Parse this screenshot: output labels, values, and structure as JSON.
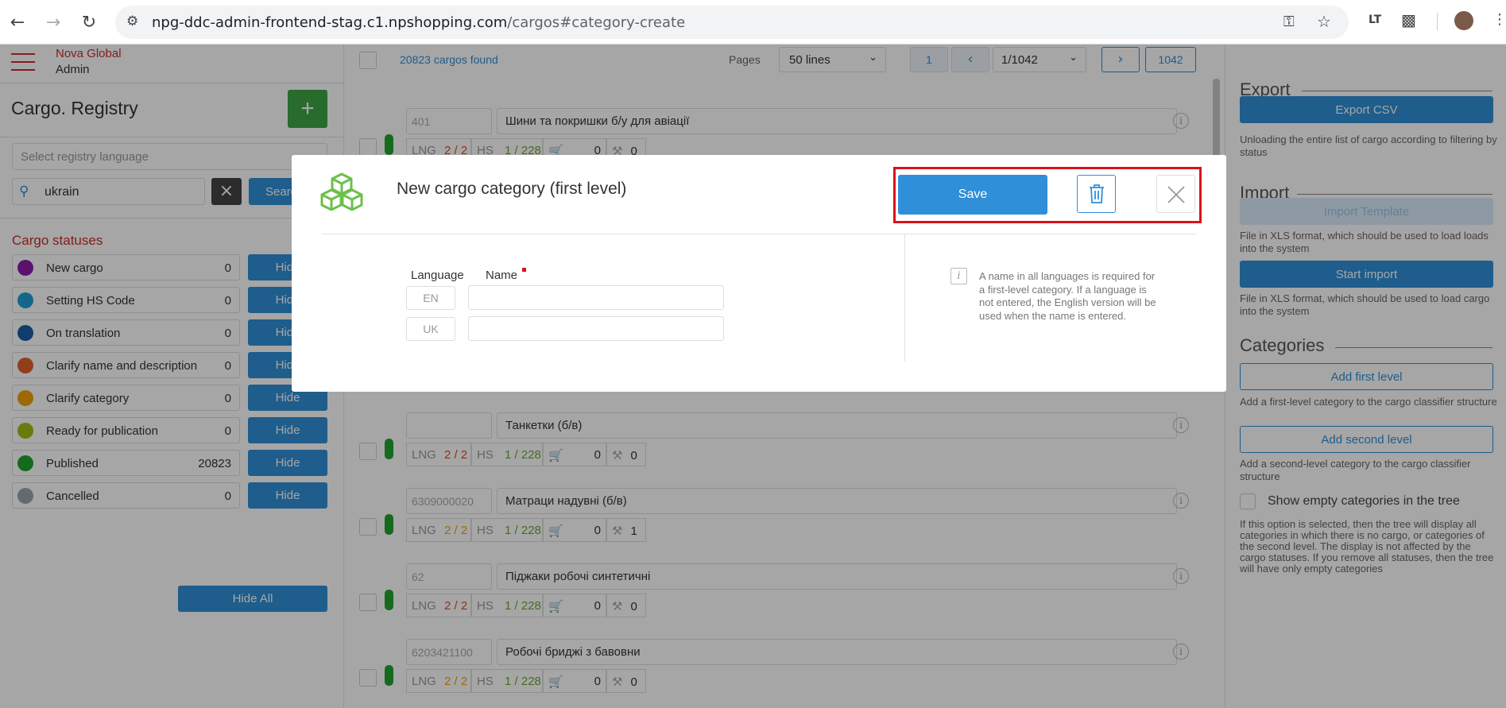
{
  "browser": {
    "url_host": "npg-ddc-admin-frontend-stag.c1.npshopping.com",
    "url_path": "/cargos#category-create",
    "ext_icon_text": "LT"
  },
  "sidebar": {
    "brand": "Nova Global",
    "role": "Admin",
    "title": "Cargo. Registry",
    "language_placeholder": "Select registry language",
    "search_value": "ukrain",
    "search_button": "Search",
    "statuses_title": "Cargo statuses",
    "statuses": [
      {
        "label": "New cargo",
        "count": "0",
        "color": "#8e1ba8",
        "action": "Hide"
      },
      {
        "label": "Setting HS Code",
        "count": "0",
        "color": "#1f9fd6",
        "action": "Hide"
      },
      {
        "label": "On translation",
        "count": "0",
        "color": "#1b5fa8",
        "action": "Hide"
      },
      {
        "label": "Clarify name and description",
        "count": "0",
        "color": "#e0602a",
        "action": "Hide"
      },
      {
        "label": "Clarify category",
        "count": "0",
        "color": "#f2a20c",
        "action": "Hide"
      },
      {
        "label": "Ready for publication",
        "count": "0",
        "color": "#9fbf12",
        "action": "Hide"
      },
      {
        "label": "Published",
        "count": "20823",
        "color": "#21a32e",
        "action": "Hide"
      },
      {
        "label": "Cancelled",
        "count": "0",
        "color": "#9aa3ad",
        "action": "Hide"
      }
    ],
    "hide_all": "Hide All"
  },
  "toolbar": {
    "found": "20823 cargos found",
    "pages_label": "Pages",
    "lines": "50 lines",
    "first_page": "1",
    "page_select": "1/1042",
    "last_page": "1042"
  },
  "rows": [
    {
      "code": "401",
      "name": "Шини та покришки б/у для авіації",
      "lng": "2 / 2",
      "lng_color": "#e04a2a",
      "hs": "1 / 228",
      "cart": "0",
      "stock": "0"
    },
    {
      "code": "",
      "name": "Танкетки (б/в)",
      "lng": "2 / 2",
      "lng_color": "#e04a2a",
      "hs": "1 / 228",
      "cart": "0",
      "stock": "0"
    },
    {
      "code": "6309000020",
      "name": "Матраци надувні (б/в)",
      "lng": "2 / 2",
      "lng_color": "#f2a20c",
      "hs": "1 / 228",
      "cart": "0",
      "stock": "1"
    },
    {
      "code": "62",
      "name": "Піджаки робочі синтетичні",
      "lng": "2 / 2",
      "lng_color": "#e04a2a",
      "hs": "1 / 228",
      "cart": "0",
      "stock": "0"
    },
    {
      "code": "6203421100",
      "name": "Робочі бриджі з бавовни",
      "lng": "2 / 2",
      "lng_color": "#f2a20c",
      "hs": "1 / 228",
      "cart": "0",
      "stock": "0"
    }
  ],
  "meta_labels": {
    "lng": "LNG",
    "hs": "HS"
  },
  "right_panel": {
    "export_title": "Export",
    "export_button": "Export CSV",
    "export_desc": "Unloading the entire list of cargo according to filtering by status",
    "import_title": "Import",
    "import_template": "Import Template",
    "import_template_desc": "File in XLS format, which should be used to load loads into the system",
    "start_import": "Start import",
    "start_import_desc": "File in XLS format, which should be used to load cargo into the system",
    "categories_title": "Categories",
    "add_first": "Add first level",
    "add_first_desc": "Add a first-level category to the cargo classifier structure",
    "add_second": "Add second level",
    "add_second_desc": "Add a second-level category to the cargo classifier structure",
    "show_empty_label": "Show empty categories in the tree",
    "show_empty_desc": "If this option is selected, then the tree will display all categories in which there is no cargo, or categories of the second level. The display is not affected by the cargo statuses. If you remove all statuses, then the tree will have only empty categories"
  },
  "modal": {
    "title": "New cargo category (first level)",
    "save": "Save",
    "language_header": "Language",
    "name_header": "Name",
    "languages": [
      {
        "code": "EN",
        "value": ""
      },
      {
        "code": "UK",
        "value": ""
      }
    ],
    "info_text": "A name in all languages is required for a first-level category. If a language is not entered, the English version will be used when the name is entered."
  },
  "colors": {
    "accent": "#2f8fd8",
    "required": "#d9121c",
    "highlight": "#d9121c",
    "brand": "#c92c2c",
    "cube": "#6cc04a"
  }
}
